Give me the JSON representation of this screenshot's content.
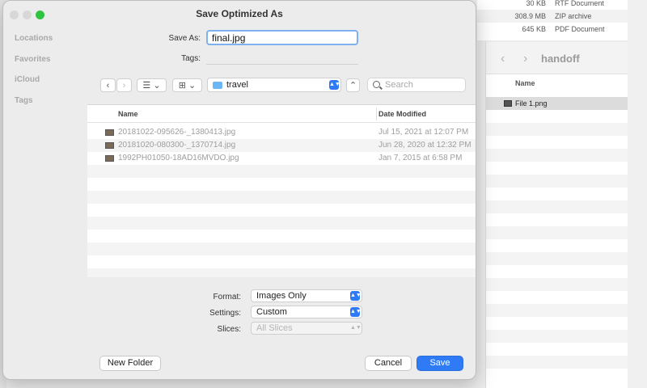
{
  "background": {
    "files": [
      {
        "size": "30 KB",
        "kind": "RTF Document"
      },
      {
        "size": "308.9 MB",
        "kind": "ZIP archive"
      },
      {
        "size": "645 KB",
        "kind": "PDF Document"
      }
    ],
    "finder": {
      "title": "handoff",
      "column_name": "Name",
      "selected_file": "File 1.png",
      "back_glyph": "‹",
      "forward_glyph": "›"
    }
  },
  "dialog": {
    "title": "Save Optimized As",
    "traffic_colors": [
      "#d8d8d8",
      "#d8d8d8",
      "#2ec440"
    ],
    "sidebar": [
      "Locations",
      "Favorites",
      "iCloud",
      "Tags"
    ],
    "save_as_label": "Save As:",
    "save_as_value": "final.jpg",
    "tags_label": "Tags:",
    "toolbar": {
      "back": "‹",
      "forward": "›",
      "list_view": "☰ ⌄",
      "grid_view": "⊞ ⌄",
      "folder": "travel",
      "expand": "⌃",
      "search_placeholder": "Search"
    },
    "columns": {
      "name": "Name",
      "date": "Date Modified"
    },
    "files": [
      {
        "name": "20181022-095626-_1380413.jpg",
        "date": "Jul 15, 2021 at 12:07 PM"
      },
      {
        "name": "20181020-080300-_1370714.jpg",
        "date": "Jun 28, 2020 at 12:32 PM"
      },
      {
        "name": "1992PH01050-18AD16MVDO.jpg",
        "date": "Jan 7, 2015 at 6:58 PM"
      }
    ],
    "options": {
      "format_label": "Format:",
      "format_value": "Images Only",
      "settings_label": "Settings:",
      "settings_value": "Custom",
      "slices_label": "Slices:",
      "slices_value": "All Slices"
    },
    "buttons": {
      "new_folder": "New Folder",
      "cancel": "Cancel",
      "save": "Save"
    },
    "accent_color": "#2f7bf5"
  }
}
